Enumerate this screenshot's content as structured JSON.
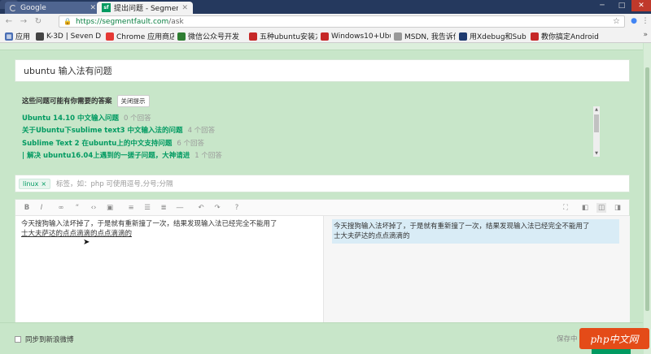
{
  "browser": {
    "tabs": [
      {
        "title": "Google"
      },
      {
        "title": "提出问题 - Segmentfault"
      }
    ],
    "url_host": "https://segmentfault.com",
    "url_path": "/ask",
    "bookmarks": [
      {
        "label": "应用",
        "color": "#4a6fb5"
      },
      {
        "label": "K-3D | Seven De",
        "color": "#444"
      },
      {
        "label": "Chrome 应用商店",
        "color": "#e53935"
      },
      {
        "label": "微信公众号开发",
        "color": "#2e7d32"
      },
      {
        "label": "五种ubuntu安装方",
        "color": "#c62828"
      },
      {
        "label": "Windows10+Ubu",
        "color": "#c62828"
      },
      {
        "label": "MSDN, 我告诉你",
        "color": "#999"
      },
      {
        "label": "用Xdebug和Sub",
        "color": "#1e3a6f"
      },
      {
        "label": "教你搞定Android",
        "color": "#c62828"
      }
    ]
  },
  "form": {
    "title_value": "ubuntu 输入法有问题",
    "similar_heading": "这些问题可能有你需要的答案",
    "similar_close": "关闭提示",
    "similar": [
      {
        "title": "Ubuntu 14.10 中文输入问题",
        "count": "0 个回答"
      },
      {
        "title": "关于Ubuntu下sublime text3 中文输入法的问题",
        "count": "4 个回答"
      },
      {
        "title": "Sublime Text 2 在ubuntu上的中文支持问题",
        "count": "6 个回答"
      },
      {
        "title": "| 解决 ubuntu16.04上遇到的一搓子问题，大神请进",
        "count": "1 个回答"
      }
    ],
    "tag": "linux",
    "tag_remove": "×",
    "tag_placeholder": "标签，如：php 可使用逗号,分号;分隔",
    "editor_line1": "今天搜狗输入法坏掉了，于是就有重新撞了一次，结果发现输入法已经完全不能用了",
    "editor_line2": "士大夫萨达的点点滴滴的点点滴滴的",
    "preview_line1": "今天搜狗输入法坏掉了，于是就有重新撞了一次，结果发现输入法已经完全不能用了",
    "preview_line2": "士大夫萨达的点点滴滴的",
    "sync_label": "同步到新浪微博",
    "save_draft": "保存中"
  },
  "watermark": "php中文网"
}
